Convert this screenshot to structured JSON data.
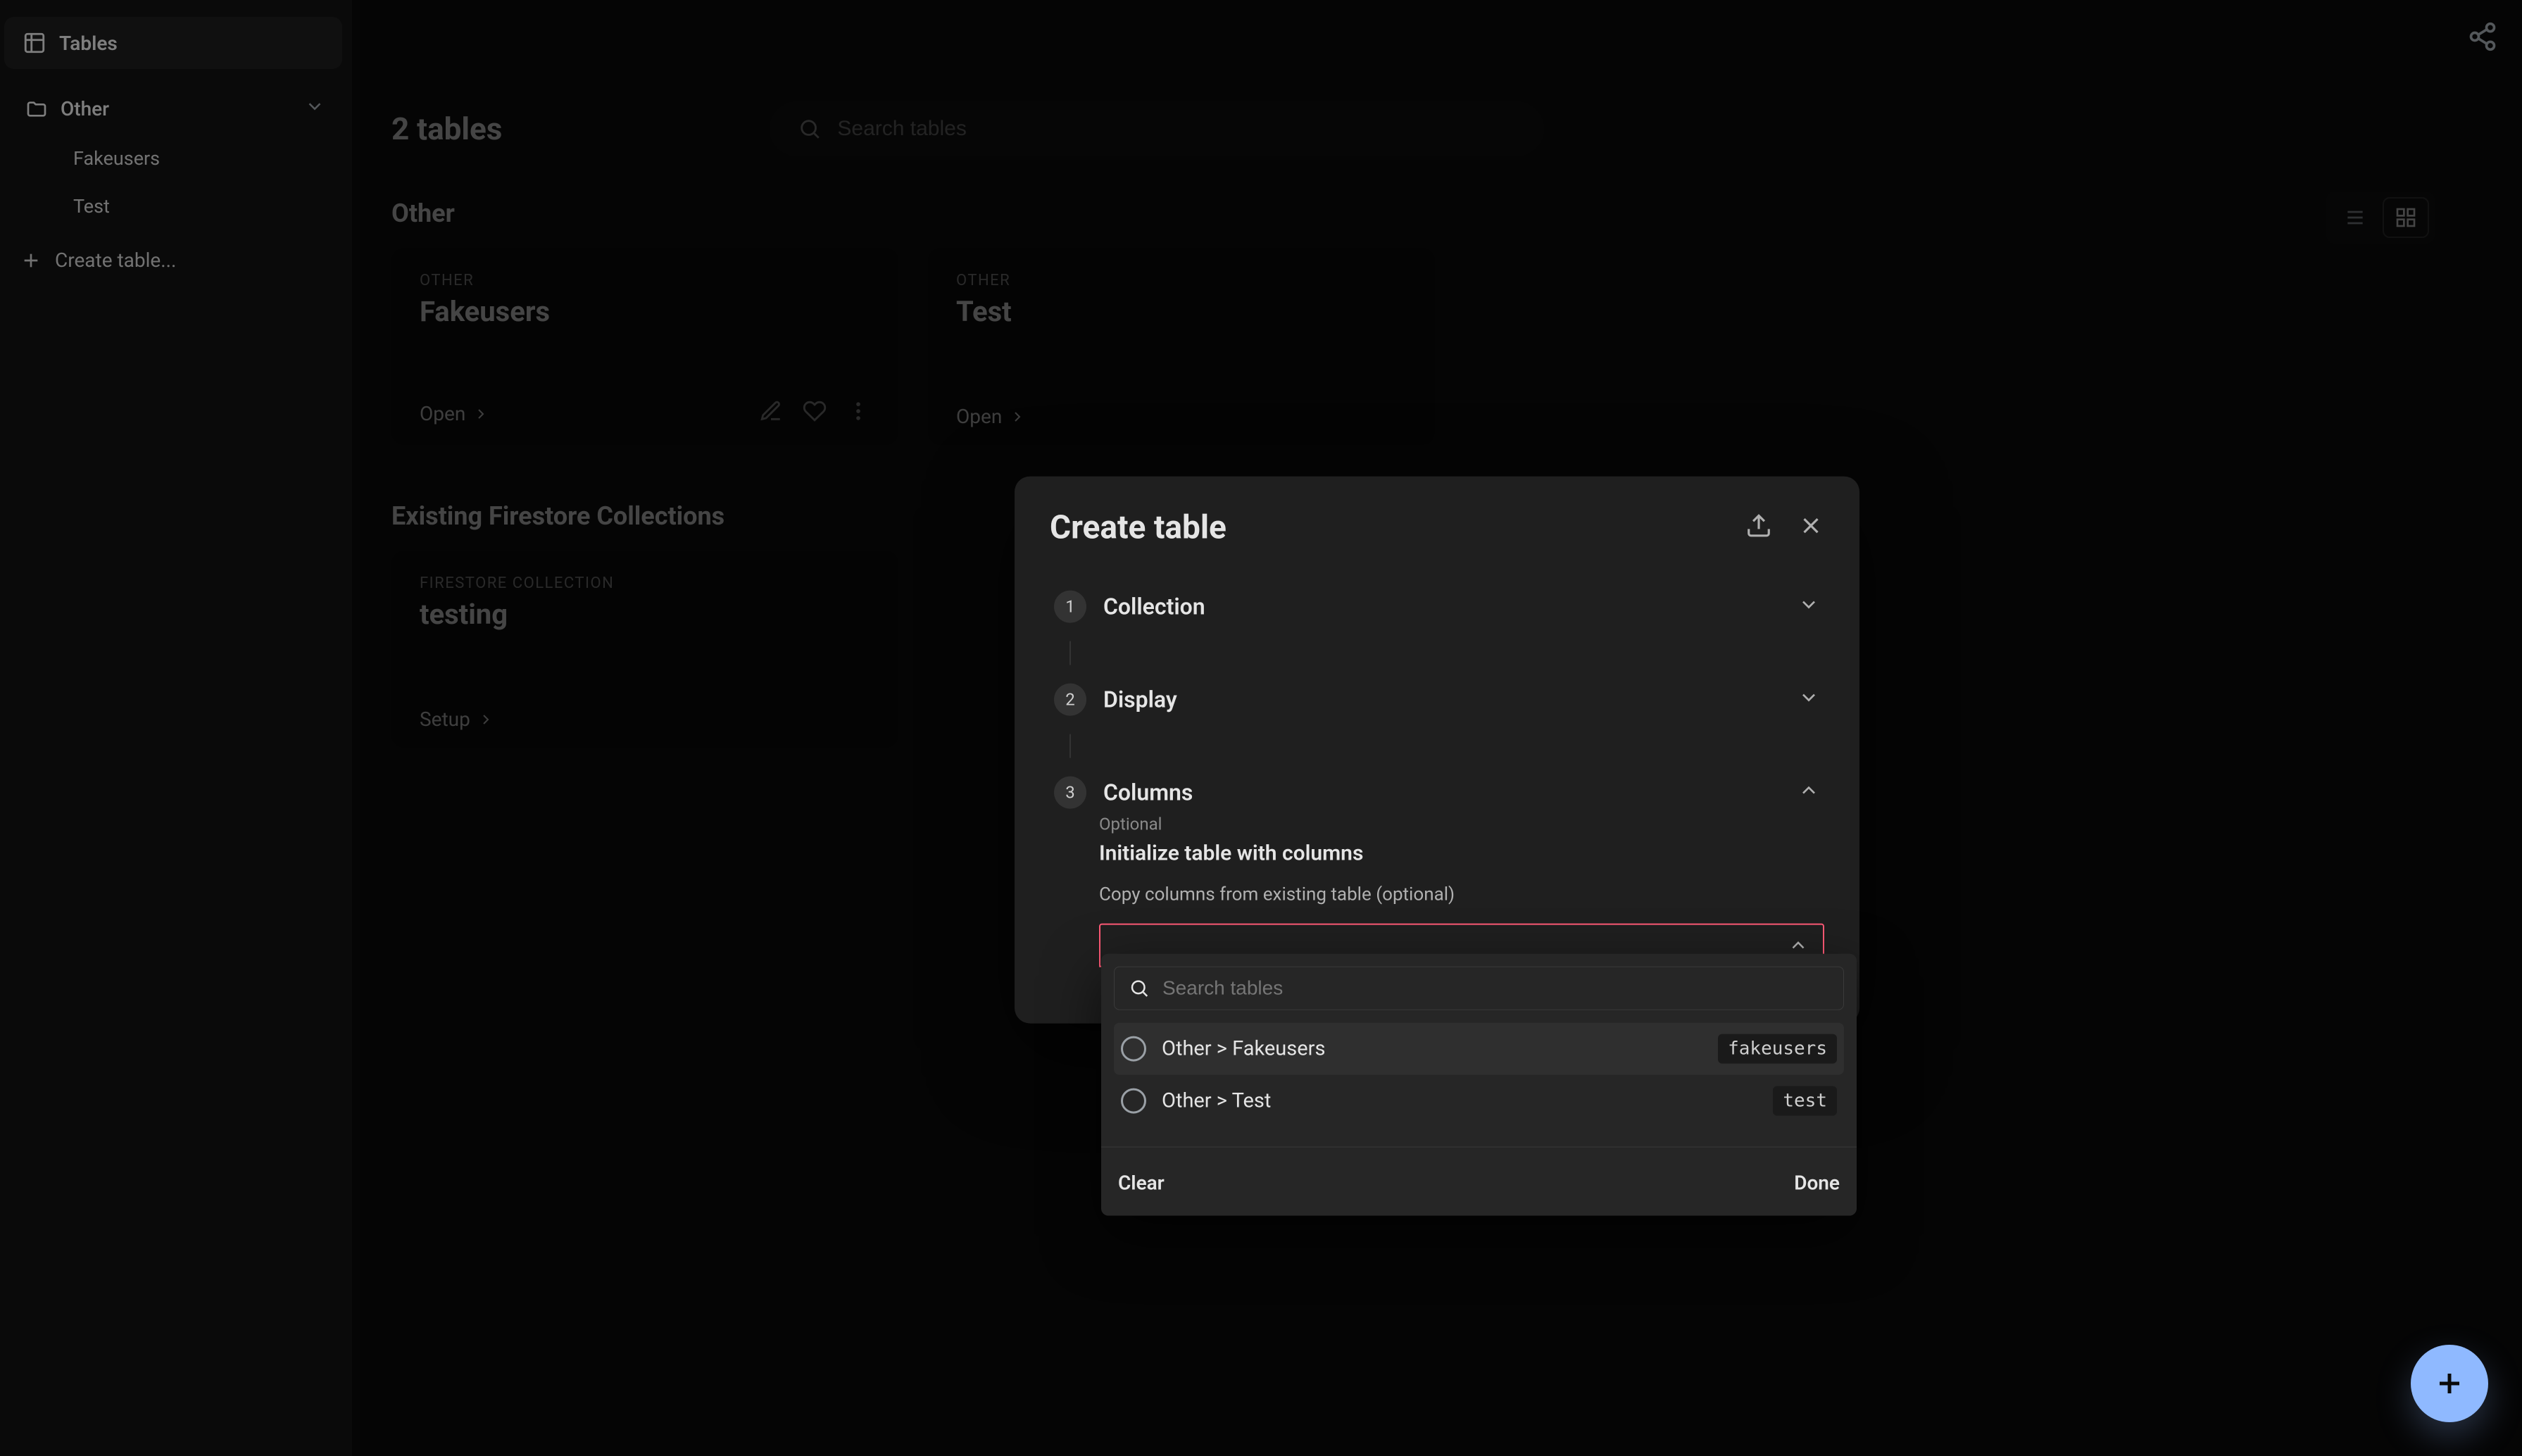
{
  "sidebar": {
    "tables_label": "Tables",
    "group": "Other",
    "items": [
      "Fakeusers",
      "Test"
    ],
    "create_table": "Create table..."
  },
  "page": {
    "title": "2 tables",
    "search_placeholder": "Search tables"
  },
  "sections": {
    "other_title": "Other",
    "existing_title": "Existing Firestore Collections"
  },
  "cards": {
    "other": [
      {
        "eyebrow": "OTHER",
        "name": "Fakeusers",
        "open": "Open"
      },
      {
        "eyebrow": "OTHER",
        "name": "Test",
        "open": "Open"
      }
    ],
    "existing": [
      {
        "eyebrow": "FIRESTORE COLLECTION",
        "name": "testing",
        "open": "Setup"
      }
    ]
  },
  "modal": {
    "title": "Create table",
    "steps": {
      "collection": {
        "num": "1",
        "label": "Collection"
      },
      "display": {
        "num": "2",
        "label": "Display"
      },
      "columns": {
        "num": "3",
        "label": "Columns",
        "sub": "Optional"
      }
    },
    "columns": {
      "init_title": "Initialize table with columns",
      "copy_label": "Copy columns from existing table (optional)"
    },
    "dropdown": {
      "search_placeholder": "Search tables",
      "options": [
        {
          "label": "Other > Fakeusers",
          "code": "fakeusers"
        },
        {
          "label": "Other > Test",
          "code": "test"
        }
      ],
      "clear": "Clear",
      "done": "Done"
    }
  }
}
